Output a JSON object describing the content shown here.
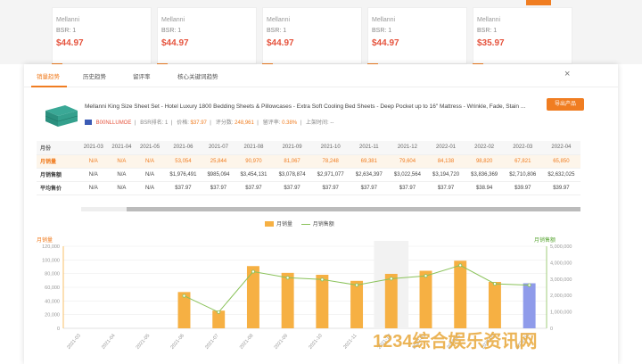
{
  "background_cards": [
    {
      "t1": "Mellanni",
      "t2": "BSR: 1",
      "price": "$44.97"
    },
    {
      "t1": "Mellanni",
      "t2": "BSR: 1",
      "price": "$44.97"
    },
    {
      "t1": "Mellanni",
      "t2": "BSR: 1",
      "price": "$44.97"
    },
    {
      "t1": "Mellanni",
      "t2": "BSR: 1",
      "price": "$44.97"
    },
    {
      "t1": "Mellanni",
      "t2": "BSR: 1",
      "price": "$35.97"
    }
  ],
  "tabs": [
    "销量趋势",
    "历史趋势",
    "留评率",
    "核心关键词趋势"
  ],
  "close_label": "×",
  "product": {
    "title": "Mellanni King Size Sheet Set - Hotel Luxury 1800 Bedding Sheets & Pillowcases - Extra Soft Cooling Bed Sheets - Deep Pocket up to 16\" Mattress - Wrinkle, Fade, Stain ...",
    "asin": "B00NLLUMOE",
    "bsr_label": "BSR排名:",
    "bsr_value": "1",
    "price_label": "价格:",
    "price_value": "$37.97",
    "rating_label": "评分数:",
    "rating_value": "248,961",
    "review_rate_label": "留评率:",
    "review_rate_value": "0.38%",
    "launch_label": "上架时间:",
    "launch_value": "--"
  },
  "export_label": "导出产品",
  "table": {
    "header_label": "月份",
    "months": [
      "2021-03",
      "2021-04",
      "2021-05",
      "2021-06",
      "2021-07",
      "2021-08",
      "2021-09",
      "2021-10",
      "2021-11",
      "2021-12",
      "2022-01",
      "2022-02",
      "2022-03",
      "2022-04"
    ],
    "rows": [
      {
        "label": "月销量",
        "values": [
          "N/A",
          "N/A",
          "N/A",
          "53,054",
          "25,844",
          "90,970",
          "81,067",
          "78,248",
          "69,381",
          "79,604",
          "84,138",
          "98,820",
          "67,821",
          "65,850"
        ]
      },
      {
        "label": "月销售额",
        "values": [
          "N/A",
          "N/A",
          "N/A",
          "$1,976,491",
          "$985,094",
          "$3,454,131",
          "$3,078,874",
          "$2,971,077",
          "$2,634,397",
          "$3,022,564",
          "$3,194,720",
          "$3,836,369",
          "$2,710,806",
          "$2,632,025"
        ]
      },
      {
        "label": "平均售价",
        "values": [
          "N/A",
          "N/A",
          "N/A",
          "$37.97",
          "$37.97",
          "$37.97",
          "$37.97",
          "$37.97",
          "$37.97",
          "$37.97",
          "$37.97",
          "$38.94",
          "$39.97",
          "$39.97"
        ]
      }
    ]
  },
  "chart_data": {
    "type": "bar",
    "categories": [
      "2021-03",
      "2021-04",
      "2021-05",
      "2021-06",
      "2021-07",
      "2021-08",
      "2021-09",
      "2021-10",
      "2021-11",
      "2021-12",
      "2022-01",
      "2022-02",
      "2022-03",
      "2022-04"
    ],
    "series": [
      {
        "name": "月销量",
        "axis": "left",
        "color": "#f6b043",
        "values": [
          0,
          0,
          0,
          53054,
          25844,
          90970,
          81067,
          78248,
          69381,
          79604,
          84138,
          98820,
          67821,
          65850
        ]
      },
      {
        "name": "月销售额",
        "axis": "right",
        "type": "line",
        "color": "#8ac25a",
        "values": [
          0,
          0,
          0,
          1976491,
          985094,
          3454131,
          3078874,
          2971077,
          2634397,
          3022564,
          3194720,
          3836369,
          2710806,
          2632025
        ]
      }
    ],
    "ylabel": "月销量",
    "y2label": "月销售额",
    "ylim": [
      0,
      120000
    ],
    "y2lim": [
      0,
      5000000
    ],
    "yticks": [
      "0",
      "20,000",
      "40,000",
      "60,000",
      "80,000",
      "100,000",
      "120,000"
    ],
    "y2ticks": [
      "0",
      "1,000,000",
      "2,000,000",
      "3,000,000",
      "4,000,000",
      "5,000,000"
    ],
    "highlight_last_bar_color": "#8f9bea",
    "grid": true,
    "legend": "top-center"
  },
  "watermark": "1234综合娱乐资讯网"
}
